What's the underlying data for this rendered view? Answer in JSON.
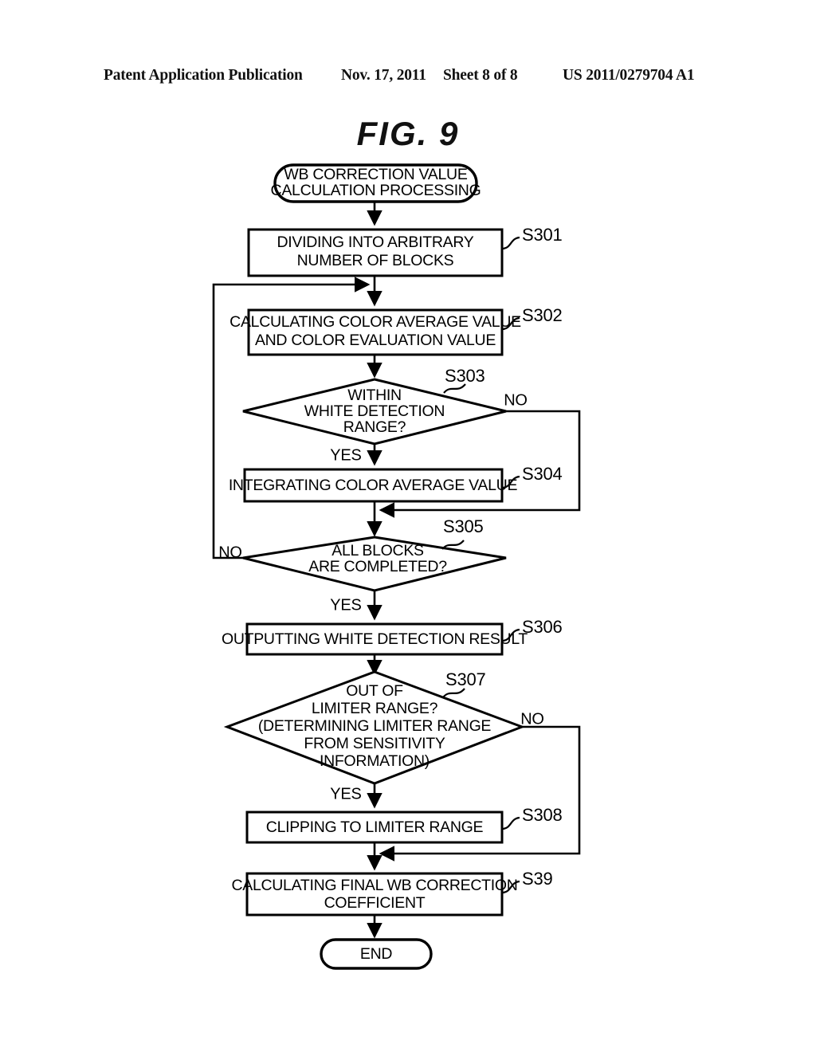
{
  "header": {
    "publication": "Patent Application Publication",
    "date": "Nov. 17, 2011",
    "sheet": "Sheet 8 of 8",
    "number": "US 2011/0279704 A1"
  },
  "figure": {
    "title": "FIG.  9"
  },
  "chart_data": {
    "type": "diagram",
    "subtype": "flowchart",
    "title": "FIG.  9",
    "nodes": [
      {
        "id": "start",
        "kind": "terminator",
        "lines": [
          "WB CORRECTION VALUE",
          "CALCULATION PROCESSING"
        ],
        "step": ""
      },
      {
        "id": "s301",
        "kind": "process",
        "lines": [
          "DIVIDING INTO ARBITRARY",
          "NUMBER OF BLOCKS"
        ],
        "step": "S301"
      },
      {
        "id": "s302",
        "kind": "process",
        "lines": [
          "CALCULATING COLOR AVERAGE VALUE",
          "AND COLOR EVALUATION VALUE"
        ],
        "step": "S302"
      },
      {
        "id": "s303",
        "kind": "decision",
        "lines": [
          "WITHIN",
          "WHITE DETECTION",
          "RANGE?"
        ],
        "step": "S303",
        "yes": "YES",
        "no": "NO"
      },
      {
        "id": "s304",
        "kind": "process",
        "lines": [
          "INTEGRATING COLOR AVERAGE VALUE"
        ],
        "step": "S304"
      },
      {
        "id": "s305",
        "kind": "decision",
        "lines": [
          "ALL BLOCKS",
          "ARE COMPLETED?"
        ],
        "step": "S305",
        "yes": "YES",
        "no": "NO"
      },
      {
        "id": "s306",
        "kind": "process",
        "lines": [
          "OUTPUTTING WHITE DETECTION RESULT"
        ],
        "step": "S306"
      },
      {
        "id": "s307",
        "kind": "decision",
        "lines": [
          "OUT OF",
          "LIMITER RANGE?",
          "(DETERMINING LIMITER RANGE",
          "FROM SENSITIVITY",
          "INFORMATION)"
        ],
        "step": "S307",
        "yes": "YES",
        "no": "NO"
      },
      {
        "id": "s308",
        "kind": "process",
        "lines": [
          "CLIPPING TO LIMITER RANGE"
        ],
        "step": "S308"
      },
      {
        "id": "s39",
        "kind": "process",
        "lines": [
          "CALCULATING FINAL WB CORRECTION",
          "COEFFICIENT"
        ],
        "step": "S39"
      },
      {
        "id": "end",
        "kind": "terminator",
        "lines": [
          "END"
        ],
        "step": ""
      }
    ],
    "edges": [
      {
        "from": "start",
        "to": "s301",
        "label": ""
      },
      {
        "from": "s301",
        "to": "s302",
        "label": ""
      },
      {
        "from": "s302",
        "to": "s303",
        "label": ""
      },
      {
        "from": "s303",
        "to": "s304",
        "label": "YES"
      },
      {
        "from": "s303",
        "to": "s305",
        "label": "NO"
      },
      {
        "from": "s304",
        "to": "s305",
        "label": ""
      },
      {
        "from": "s305",
        "to": "s302",
        "label": "NO"
      },
      {
        "from": "s305",
        "to": "s306",
        "label": "YES"
      },
      {
        "from": "s306",
        "to": "s307",
        "label": ""
      },
      {
        "from": "s307",
        "to": "s308",
        "label": "YES"
      },
      {
        "from": "s307",
        "to": "s39",
        "label": "NO"
      },
      {
        "from": "s308",
        "to": "s39",
        "label": ""
      },
      {
        "from": "s39",
        "to": "end",
        "label": ""
      }
    ]
  },
  "labels": {
    "start_l1": "WB CORRECTION VALUE",
    "start_l2": "CALCULATION PROCESSING",
    "s301_l1": "DIVIDING INTO ARBITRARY",
    "s301_l2": "NUMBER OF BLOCKS",
    "s301_id": "S301",
    "s302_l1": "CALCULATING COLOR AVERAGE VALUE",
    "s302_l2": "AND COLOR EVALUATION VALUE",
    "s302_id": "S302",
    "s303_l1": "WITHIN",
    "s303_l2": "WHITE DETECTION",
    "s303_l3": "RANGE?",
    "s303_id": "S303",
    "s303_no": "NO",
    "s303_yes": "YES",
    "s304_l1": "INTEGRATING COLOR AVERAGE VALUE",
    "s304_id": "S304",
    "s305_l1": "ALL BLOCKS",
    "s305_l2": "ARE COMPLETED?",
    "s305_id": "S305",
    "s305_no": "NO",
    "s305_yes": "YES",
    "s306_l1": "OUTPUTTING WHITE DETECTION RESULT",
    "s306_id": "S306",
    "s307_l1": "OUT OF",
    "s307_l2": "LIMITER RANGE?",
    "s307_l3": "(DETERMINING LIMITER RANGE",
    "s307_l4": "FROM SENSITIVITY",
    "s307_l5": "INFORMATION)",
    "s307_id": "S307",
    "s307_no": "NO",
    "s307_yes": "YES",
    "s308_l1": "CLIPPING TO LIMITER RANGE",
    "s308_id": "S308",
    "s39_l1": "CALCULATING FINAL WB CORRECTION",
    "s39_l2": "COEFFICIENT",
    "s39_id": "S39",
    "end_l1": "END"
  },
  "colors": {
    "ink": "#000000",
    "paper": "#ffffff"
  }
}
